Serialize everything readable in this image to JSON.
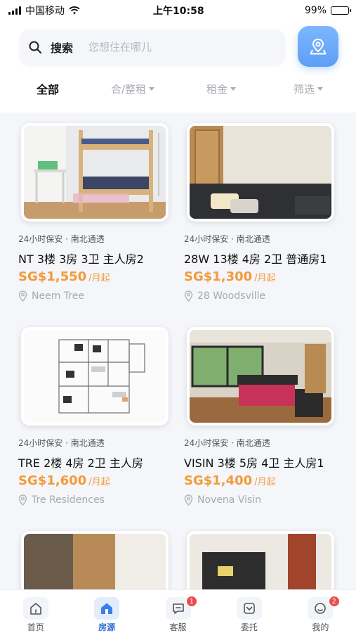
{
  "status_bar": {
    "carrier": "中国移动",
    "time": "上午10:58",
    "battery_percent": "99%",
    "battery_level": 0.99
  },
  "search": {
    "label": "搜索",
    "placeholder": "您想住在哪儿",
    "value": ""
  },
  "map_button": {
    "icon": "map-location-icon"
  },
  "filters": [
    {
      "label": "全部",
      "active": true
    },
    {
      "label": "合/整租",
      "active": false
    },
    {
      "label": "租金",
      "active": false
    },
    {
      "label": "筛选",
      "active": false
    }
  ],
  "listings": [
    {
      "tags": "24小时保安 · 南北通透",
      "title": "NT 3楼 3房 3卫 主人房2",
      "price": "SG$1,550",
      "price_unit": "/月起",
      "location": "Neem Tree",
      "photo": "bunk-bed-room"
    },
    {
      "tags": "24小时保安 · 南北通透",
      "title": "28W 13楼 4房 2卫 普通房1",
      "price": "SG$1,300",
      "price_unit": "/月起",
      "location": "28 Woodsville",
      "photo": "wardrobe-room"
    },
    {
      "tags": "24小时保安 · 南北通透",
      "title": "TRE 2楼 4房 2卫 主人房",
      "price": "SG$1,600",
      "price_unit": "/月起",
      "location": "Tre Residences",
      "photo": "floor-plan"
    },
    {
      "tags": "24小时保安 · 南北通透",
      "title": "VISIN 3楼 5房 4卫 主人房1",
      "price": "SG$1,400",
      "price_unit": "/月起",
      "location": "Novena Visin",
      "photo": "bedroom-window"
    },
    {
      "photo": "partial-room-1"
    },
    {
      "photo": "partial-room-2"
    }
  ],
  "tabbar": [
    {
      "label": "首页",
      "icon": "home-icon",
      "active": false,
      "badge": ""
    },
    {
      "label": "房源",
      "icon": "house-icon",
      "active": true,
      "badge": ""
    },
    {
      "label": "客服",
      "icon": "chat-icon",
      "active": false,
      "badge": "1"
    },
    {
      "label": "委托",
      "icon": "delegate-icon",
      "active": false,
      "badge": ""
    },
    {
      "label": "我的",
      "icon": "profile-icon",
      "active": false,
      "badge": "2"
    }
  ],
  "colors": {
    "accent": "#5d9ff5",
    "price": "#f39a3b",
    "badge": "#ee4b4b",
    "tab_active": "#2f6fd6"
  }
}
